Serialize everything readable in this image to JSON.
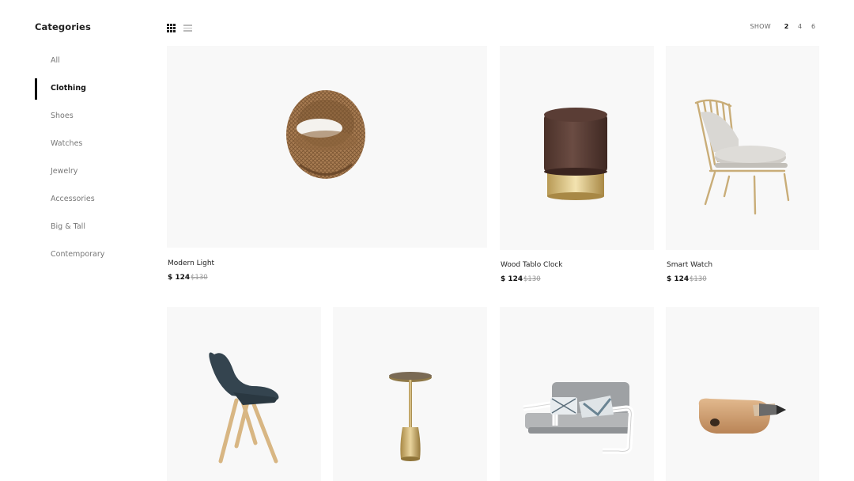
{
  "sidebar": {
    "title": "Categories",
    "items": [
      {
        "label": "All"
      },
      {
        "label": "Clothing",
        "active": true
      },
      {
        "label": "Shoes"
      },
      {
        "label": "Watches"
      },
      {
        "label": "Jewelry"
      },
      {
        "label": "Accessories"
      },
      {
        "label": "Big & Tall"
      },
      {
        "label": "Contemporary"
      }
    ]
  },
  "toolbar": {
    "grid_icon": "grid-view-icon",
    "list_icon": "list-view-icon",
    "show_label": "SHOW",
    "show_options": [
      "2",
      "4",
      "6"
    ],
    "show_selected": "2"
  },
  "products": [
    {
      "name": "Modern Light",
      "price": "$ 124",
      "old_price": "$130",
      "image": "wicker-egg-chair"
    },
    {
      "name": "Wood Tablo Clock",
      "price": "$ 124",
      "old_price": "$130",
      "image": "velvet-pouf-stool"
    },
    {
      "name": "Smart Watch",
      "price": "$ 124",
      "old_price": "$130",
      "image": "lounge-armchair"
    },
    {
      "name": "",
      "price": "",
      "old_price": "",
      "image": "scandi-shell-chair"
    },
    {
      "name": "",
      "price": "",
      "old_price": "",
      "image": "gold-side-table"
    },
    {
      "name": "",
      "price": "",
      "old_price": "",
      "image": "grey-sofa-bed"
    },
    {
      "name": "",
      "price": "",
      "old_price": "",
      "image": "wooden-pencil-sharpener"
    }
  ]
}
